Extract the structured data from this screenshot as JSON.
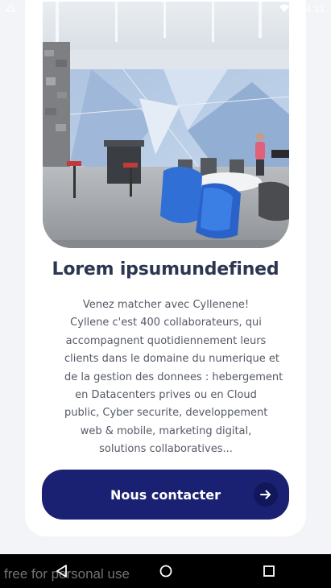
{
  "status_bar": {
    "time": "4:31",
    "icons": [
      "notification-icon",
      "wifi-icon",
      "battery-icon"
    ]
  },
  "card": {
    "image_alt": "office-lounge-photo",
    "title": "Lorem ipsumundefined",
    "description_lines": [
      "Venez matcher avec Cyllenene!",
      "Cyllene c'est 400 collaborateurs, qui",
      "accompagnent quotidiennement leurs",
      "clients dans le domaine du numerique et",
      "de la gestion des donnees : hebergement",
      "en Datacenters prives ou en Cloud",
      "public, Cyber securite, developpement",
      "web & mobile, marketing digital,",
      "solutions collaboratives..."
    ],
    "button_label": "Nous contacter",
    "button_icon": "arrow-right-icon"
  },
  "nav_bar": {
    "buttons": [
      "back-icon",
      "home-icon",
      "recent-apps-icon"
    ]
  },
  "watermark": "free for personal use",
  "colors": {
    "background": "#f3f4f7",
    "card": "#ffffff",
    "title": "#2d3650",
    "text": "#555a66",
    "button": "#1a2172",
    "nav_bar": "#000000"
  }
}
